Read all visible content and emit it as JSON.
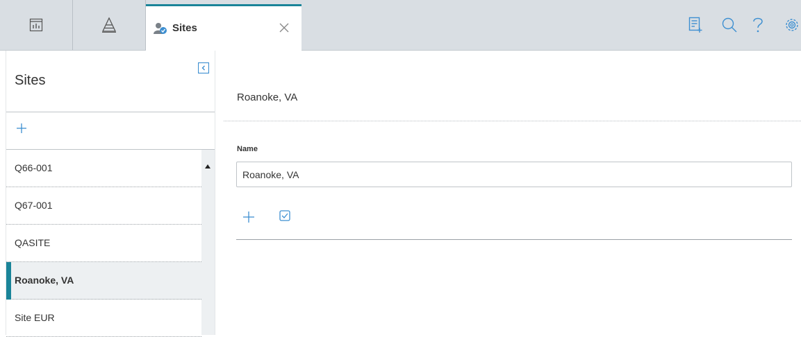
{
  "tabs": {
    "active_title": "Sites"
  },
  "sidebar": {
    "title": "Sites",
    "items": [
      {
        "label": "Q66-001"
      },
      {
        "label": "Q67-001"
      },
      {
        "label": "QASITE"
      },
      {
        "label": "Roanoke, VA",
        "selected": true
      },
      {
        "label": "Site EUR"
      }
    ]
  },
  "detail": {
    "title": "Roanoke, VA",
    "name_label": "Name",
    "name_value": "Roanoke, VA"
  },
  "colors": {
    "accent": "#1a8499",
    "icon_blue": "#3d8fd1",
    "topbar_bg": "#d9dee3"
  }
}
